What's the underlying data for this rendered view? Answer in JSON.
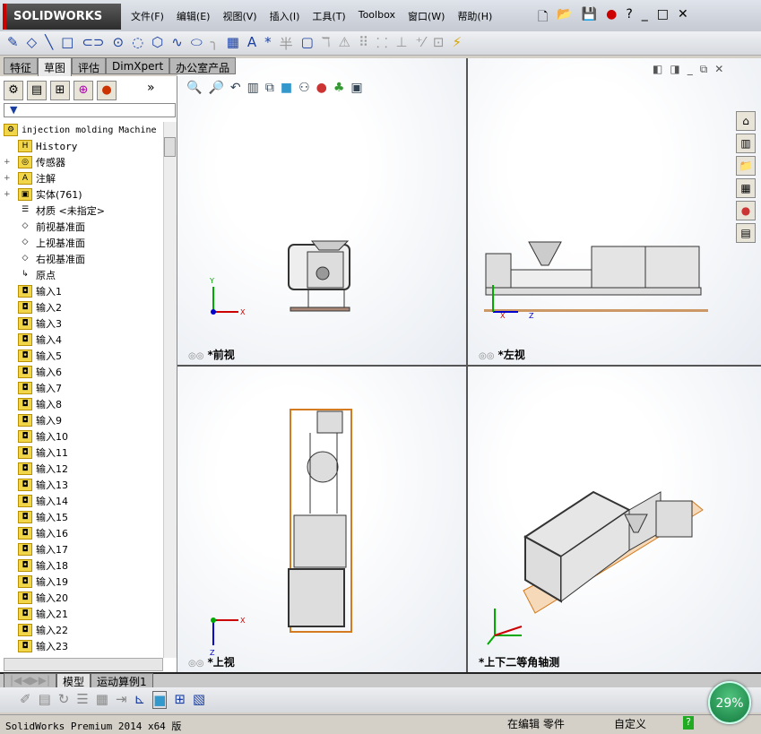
{
  "app": {
    "logo": "SOLIDWORKS"
  },
  "menu": [
    "文件(F)",
    "编辑(E)",
    "视图(V)",
    "插入(I)",
    "工具(T)",
    "Toolbox",
    "窗口(W)",
    "帮助(H)"
  ],
  "tabs": [
    "特征",
    "草图",
    "评估",
    "DimXpert",
    "办公室产品"
  ],
  "active_tab": "草图",
  "filter_icon": "filter-icon",
  "tree": {
    "root": "injection molding Machine",
    "items": [
      "History",
      "传感器",
      "注解",
      "实体(761)",
      "材质 <未指定>",
      "前视基准面",
      "上视基准面",
      "右视基准面",
      "原点",
      "输入1",
      "输入2",
      "输入3",
      "输入4",
      "输入5",
      "输入6",
      "输入7",
      "输入8",
      "输入9",
      "输入10",
      "输入11",
      "输入12",
      "输入13",
      "输入14",
      "输入15",
      "输入16",
      "输入17",
      "输入18",
      "输入19",
      "输入20",
      "输入21",
      "输入22",
      "输入23"
    ]
  },
  "views": {
    "front": "*前视",
    "left": "*左视",
    "top": "*上视",
    "iso": "*上下二等角轴测"
  },
  "bottom_tabs": [
    "模型",
    "运动算例1"
  ],
  "status": {
    "version": "SolidWorks Premium 2014 x64 版",
    "editing": "在编辑 零件",
    "custom": "自定义",
    "help": "?"
  },
  "perf": "29%"
}
